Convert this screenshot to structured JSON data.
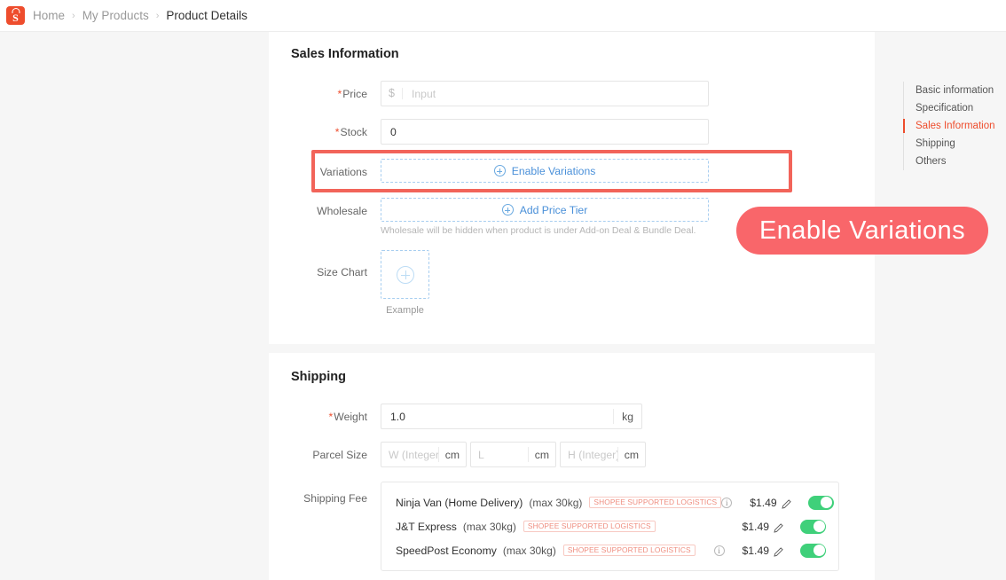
{
  "breadcrumb": {
    "logo_letter": "S",
    "items": [
      {
        "label": "Home",
        "active": false
      },
      {
        "label": "My Products",
        "active": false
      },
      {
        "label": "Product Details",
        "active": true
      }
    ],
    "separator": "›"
  },
  "sales": {
    "title": "Sales Information",
    "price": {
      "label": "Price",
      "required_mark": "*",
      "currency_prefix": "$",
      "placeholder": "Input",
      "value": ""
    },
    "stock": {
      "label": "Stock",
      "required_mark": "*",
      "value": "0"
    },
    "variations": {
      "label": "Variations",
      "button_label": "Enable Variations",
      "icon": "circle-plus-icon"
    },
    "wholesale": {
      "label": "Wholesale",
      "button_label": "Add Price Tier",
      "icon": "circle-plus-icon",
      "hint": "Wholesale will be hidden when product is under Add-on Deal & Bundle Deal."
    },
    "size_chart": {
      "label": "Size Chart",
      "upload_icon": "circle-plus-icon",
      "caption": "Example"
    }
  },
  "shipping": {
    "title": "Shipping",
    "weight": {
      "label": "Weight",
      "required_mark": "*",
      "value": "1.0",
      "unit": "kg"
    },
    "parcel_size": {
      "label": "Parcel Size",
      "fields": [
        {
          "placeholder": "W (Integer)",
          "value": "",
          "unit": "cm"
        },
        {
          "placeholder": "L",
          "value": "",
          "unit": "cm"
        },
        {
          "placeholder": "H (Integer)",
          "value": "",
          "unit": "cm"
        }
      ]
    },
    "shipping_fee": {
      "label": "Shipping Fee",
      "badge_text": "SHOPEE SUPPORTED LOGISTICS",
      "rows": [
        {
          "name": "Ninja Van (Home Delivery)",
          "max_weight": "(max 30kg)",
          "badge": "SHOPEE SUPPORTED LOGISTICS",
          "has_info_icon": true,
          "price": "$1.49",
          "enabled": true
        },
        {
          "name": "J&T Express",
          "max_weight": "(max 30kg)",
          "badge": "SHOPEE SUPPORTED LOGISTICS",
          "has_info_icon": false,
          "price": "$1.49",
          "enabled": true
        },
        {
          "name": "SpeedPost Economy",
          "max_weight": "(max 30kg)",
          "badge": "SHOPEE SUPPORTED LOGISTICS",
          "has_info_icon": true,
          "price": "$1.49",
          "enabled": true
        }
      ]
    }
  },
  "anchor_nav": {
    "items": [
      {
        "label": "Basic information",
        "active": false
      },
      {
        "label": "Specification",
        "active": false
      },
      {
        "label": "Sales Information",
        "active": true
      },
      {
        "label": "Shipping",
        "active": false
      },
      {
        "label": "Others",
        "active": false
      }
    ]
  },
  "callout": {
    "text": "Enable Variations",
    "background": "#f9666a",
    "text_color": "#ffffff"
  },
  "highlight": {
    "target": "variations-row",
    "color": "#f2645a"
  },
  "colors": {
    "brand": "#ee4d2d",
    "link": "#4a90d9",
    "toggle_on": "#3fd07a",
    "badge_text": "#ef8d7f",
    "page_background": "#f6f6f6"
  }
}
